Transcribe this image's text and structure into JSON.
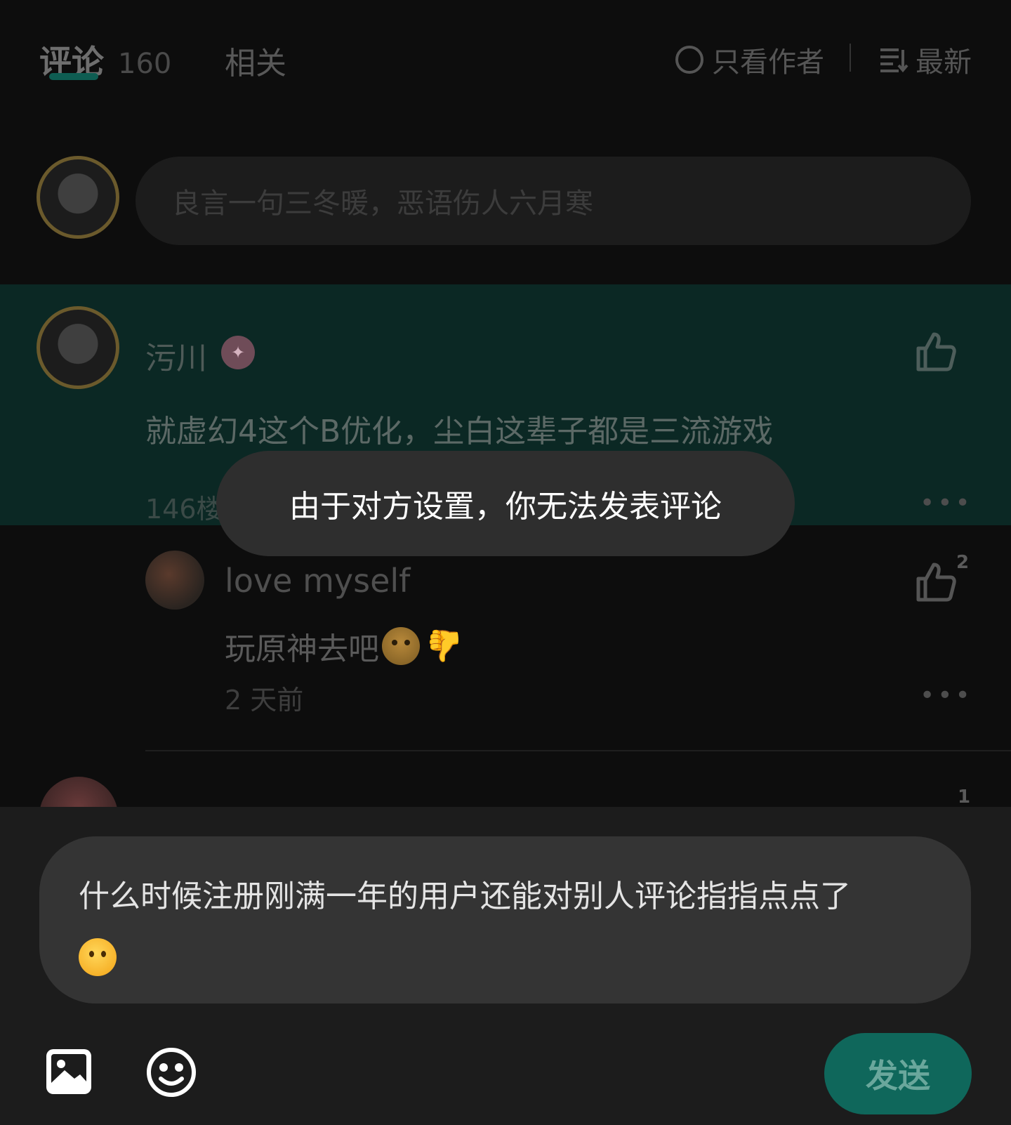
{
  "tabs": {
    "comments_label": "评论",
    "comments_count": "160",
    "related_label": "相关",
    "author_only_label": "只看作者",
    "sort_label": "最新"
  },
  "compose": {
    "placeholder": "良言一句三冬暖，恶语伤人六月寒"
  },
  "comment": {
    "username": "污川",
    "text": "就虚幻4这个B优化，尘白这辈子都是三流游戏",
    "floor": "146楼",
    "more": "•••"
  },
  "reply": {
    "username": "love myself",
    "text": "玩原神去吧",
    "time": "2 天前",
    "like_count": "2",
    "more": "•••"
  },
  "next_comment": {
    "like_count": "1"
  },
  "toast": {
    "message": "由于对方设置，你无法发表评论"
  },
  "input": {
    "text": "什么时候注册刚满一年的用户还能对别人评论指指点点了"
  },
  "actions": {
    "send_label": "发送"
  },
  "colors": {
    "accent": "#0f675b",
    "highlight_bg": "#0b2824",
    "toast_bg": "#2e2e2e"
  }
}
